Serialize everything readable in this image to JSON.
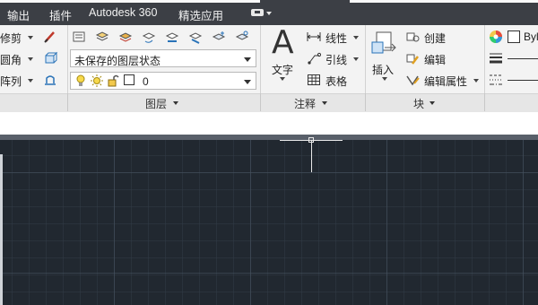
{
  "menubar": {
    "items": [
      "输出",
      "插件",
      "Autodesk 360",
      "精选应用"
    ]
  },
  "modify_panel": {
    "buttons": [
      "修剪",
      "圆角",
      "阵列"
    ]
  },
  "layers_panel": {
    "title": "图层",
    "layer_state": "未保存的图层状态",
    "current_layer": "0"
  },
  "annotation_panel": {
    "title": "注释",
    "text_label": "文字",
    "linear_label": "线性",
    "leader_label": "引线",
    "table_label": "表格"
  },
  "block_panel": {
    "title": "块",
    "insert_label": "插入",
    "create_label": "创建",
    "edit_label": "编辑",
    "edit_attributes_label": "编辑属性"
  },
  "properties_panel": {
    "color_value": "Byl"
  },
  "colors": {
    "menubar_bg": "#3c3f45",
    "ribbon_bg": "#f3f3f3",
    "canvas_bg": "#212830"
  }
}
